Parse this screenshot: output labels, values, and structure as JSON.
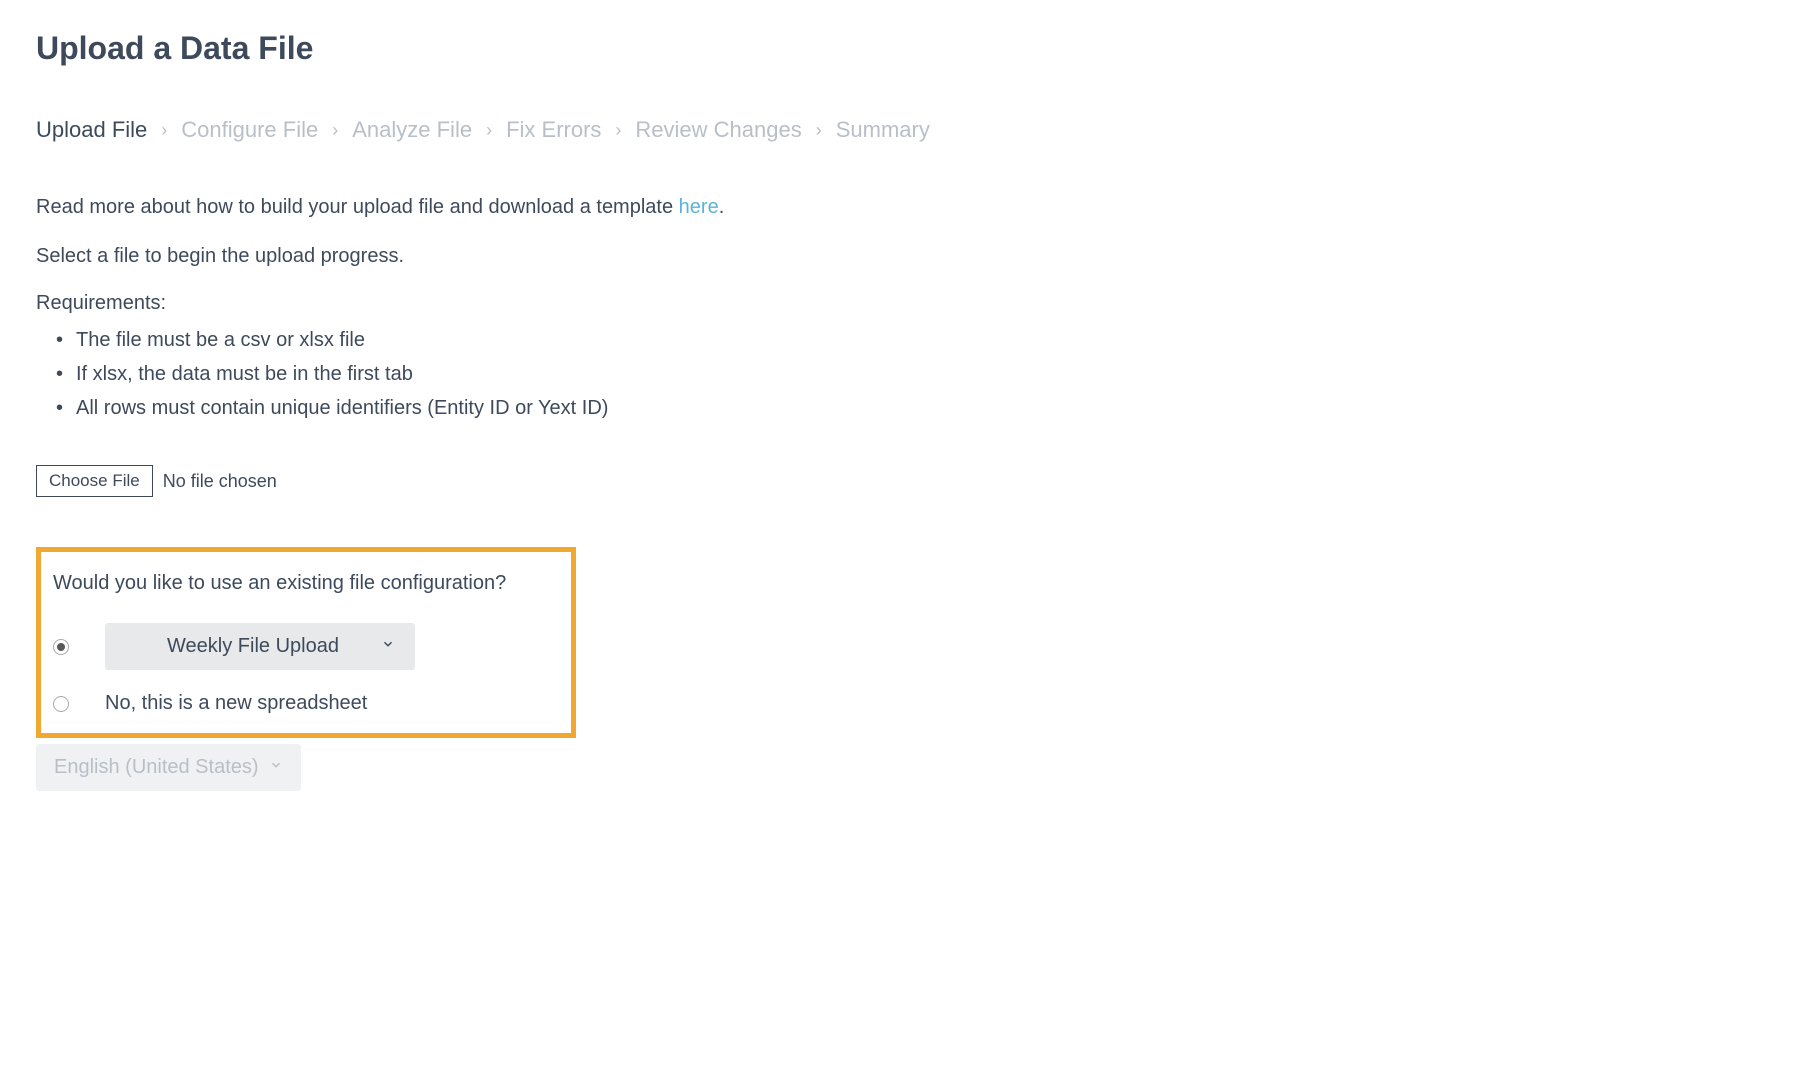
{
  "page": {
    "title": "Upload a Data File"
  },
  "breadcrumb": {
    "items": [
      {
        "label": "Upload File",
        "active": true
      },
      {
        "label": "Configure File",
        "active": false
      },
      {
        "label": "Analyze File",
        "active": false
      },
      {
        "label": "Fix Errors",
        "active": false
      },
      {
        "label": "Review Changes",
        "active": false
      },
      {
        "label": "Summary",
        "active": false
      }
    ]
  },
  "intro": {
    "prefix": "Read more about how to build your upload file and download a template ",
    "link_text": "here",
    "suffix": "."
  },
  "select_file_text": "Select a file to begin the upload progress.",
  "requirements": {
    "heading": "Requirements:",
    "items": [
      "The file must be a csv or xlsx file",
      "If xlsx, the data must be in the first tab",
      "All rows must contain unique identifiers (Entity ID or Yext ID)"
    ]
  },
  "file_picker": {
    "button_label": "Choose File",
    "status": "No file chosen"
  },
  "config": {
    "question": "Would you like to use an existing file configuration?",
    "existing_dropdown": {
      "selected": "Weekly File Upload"
    },
    "new_label": "No, this is a new spreadsheet",
    "selected_option": "existing"
  },
  "language": {
    "selected": "English (United States)"
  }
}
